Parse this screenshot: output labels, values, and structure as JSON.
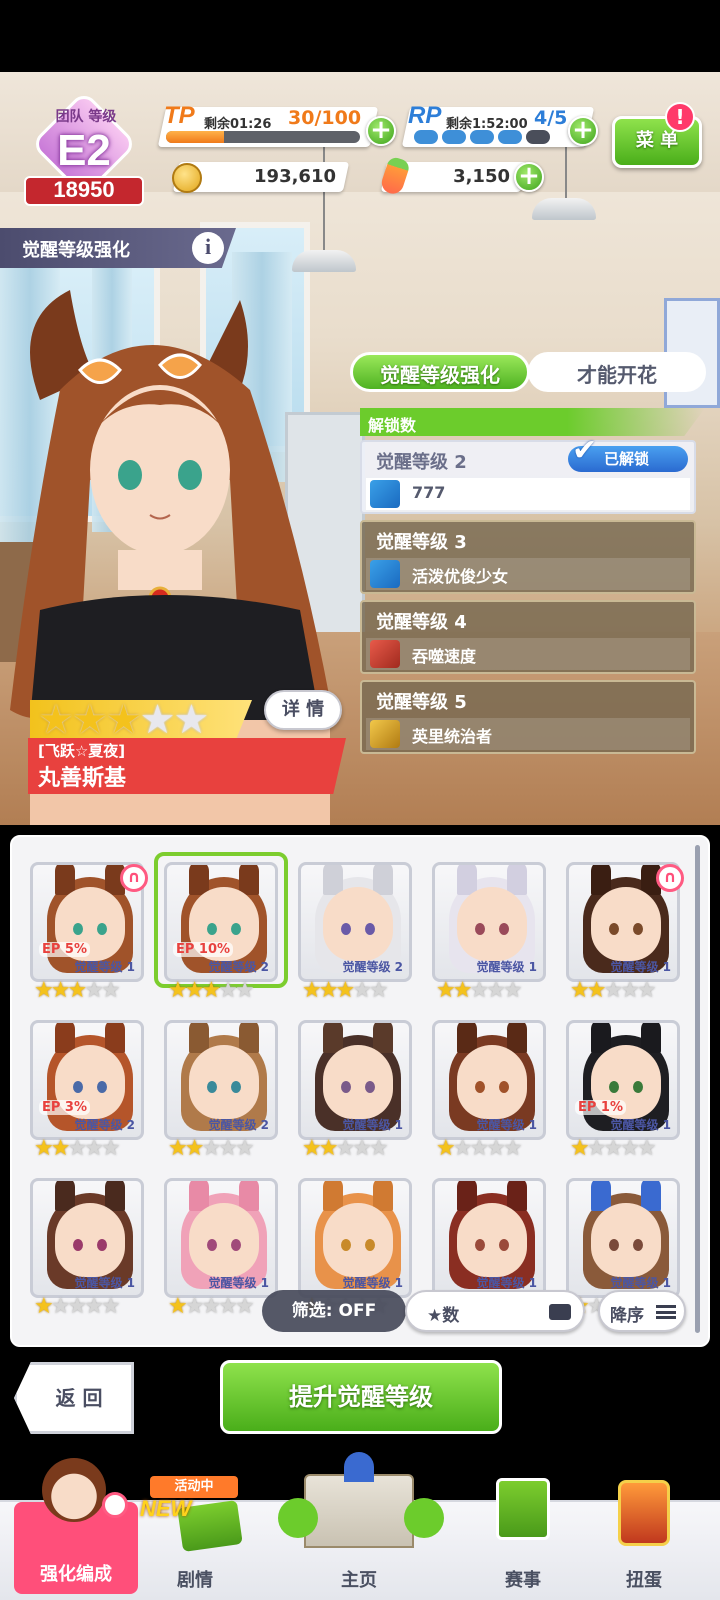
{
  "header": {
    "team_rank_title": "团队 等级",
    "team_rank": "E2",
    "team_score": "18950",
    "tp": {
      "label": "TP",
      "remain_label": "剩余01:26",
      "value": "30/100",
      "fill": 0.3
    },
    "rp": {
      "label": "RP",
      "remain_label": "剩余1:52:00",
      "value": "4/5",
      "filled": 4,
      "total": 5
    },
    "coins": "193,610",
    "carrots": "3,150",
    "menu_label": "菜 单",
    "menu_badge": "!"
  },
  "page_title": "觉醒等级强化",
  "info_icon": "i",
  "panel": {
    "tabs": [
      {
        "label": "觉醒等级强化",
        "active": true
      },
      {
        "label": "才能开花",
        "active": false
      }
    ],
    "section_label": "解锁数",
    "levels": [
      {
        "title": "觉醒等级 2",
        "skill": "777",
        "unlocked": true,
        "badge": "已解锁",
        "icon": "sparkle-blue-icon"
      },
      {
        "title": "觉醒等级 3",
        "skill": "活泼优俊少女",
        "unlocked": false,
        "icon": "sparkle-blue-icon"
      },
      {
        "title": "觉醒等级 4",
        "skill": "吞噬速度",
        "unlocked": false,
        "icon": "speed-red-icon"
      },
      {
        "title": "觉醒等级 5",
        "skill": "英里统治者",
        "unlocked": false,
        "icon": "crown-gold-icon"
      }
    ]
  },
  "character": {
    "stars": 3,
    "max_stars": 5,
    "epithet": "[飞跃☆夏夜]",
    "name": "丸善斯基",
    "detail_button": "详 情"
  },
  "roster": [
    {
      "awakening": "觉醒等级 1",
      "stars": 3,
      "ep": "EP 5%",
      "hair": "#a0532a",
      "ears": "#7a3a1c",
      "eyes": "#3aa38c",
      "horseshoe": true,
      "selected": false
    },
    {
      "awakening": "觉醒等级 2",
      "stars": 3,
      "ep": "EP 10%",
      "hair": "#a0532a",
      "ears": "#7a3a1c",
      "eyes": "#3aa38c",
      "horseshoe": false,
      "selected": true
    },
    {
      "awakening": "觉醒等级 2",
      "stars": 3,
      "ep": "",
      "hair": "#e6e6ea",
      "ears": "#cfd0d8",
      "eyes": "#6a5aa8",
      "horseshoe": false,
      "selected": false
    },
    {
      "awakening": "觉醒等级 1",
      "stars": 2,
      "ep": "",
      "hair": "#e7e4ee",
      "ears": "#d2cfe0",
      "eyes": "#9a4a5a",
      "horseshoe": false,
      "selected": false
    },
    {
      "awakening": "觉醒等级 1",
      "stars": 2,
      "ep": "",
      "hair": "#4a2a1c",
      "ears": "#3a1e12",
      "eyes": "#7a4a2a",
      "horseshoe": true,
      "selected": false
    },
    {
      "awakening": "觉醒等级 2",
      "stars": 2,
      "ep": "EP 3%",
      "hair": "#b5552a",
      "ears": "#8a3c1c",
      "eyes": "#4a6aa8",
      "horseshoe": false,
      "selected": false
    },
    {
      "awakening": "觉醒等级 2",
      "stars": 2,
      "ep": "",
      "hair": "#b07a4a",
      "ears": "#8a5a32",
      "eyes": "#3a8a9a",
      "horseshoe": false,
      "selected": false
    },
    {
      "awakening": "觉醒等级 1",
      "stars": 2,
      "ep": "",
      "hair": "#4a3028",
      "ears": "#5a3a2a",
      "eyes": "#7a5a8a",
      "horseshoe": false,
      "selected": false
    },
    {
      "awakening": "觉醒等级 1",
      "stars": 1,
      "ep": "",
      "hair": "#7a3a22",
      "ears": "#5a2a16",
      "eyes": "#a0522a",
      "horseshoe": false,
      "selected": false
    },
    {
      "awakening": "觉醒等级 1",
      "stars": 1,
      "ep": "EP 1%",
      "hair": "#1e1e22",
      "ears": "#1a1a1e",
      "eyes": "#3a7a3a",
      "horseshoe": false,
      "selected": false
    },
    {
      "awakening": "觉醒等级 1",
      "stars": 1,
      "ep": "",
      "hair": "#6a3a28",
      "ears": "#4a2a1e",
      "eyes": "#9a3a6a",
      "horseshoe": false,
      "selected": false
    },
    {
      "awakening": "觉醒等级 1",
      "stars": 1,
      "ep": "",
      "hair": "#f0a2b8",
      "ears": "#e88aa6",
      "eyes": "#a04a7a",
      "horseshoe": false,
      "selected": false
    },
    {
      "awakening": "觉醒等级 1",
      "stars": 1,
      "ep": "",
      "hair": "#e8924a",
      "ears": "#d07a32",
      "eyes": "#c88a2a",
      "horseshoe": false,
      "selected": false
    },
    {
      "awakening": "觉醒等级 1",
      "stars": 1,
      "ep": "",
      "hair": "#8a2e22",
      "ears": "#6a2218",
      "eyes": "#9a4a3a",
      "horseshoe": false,
      "selected": false
    },
    {
      "awakening": "觉醒等级 1",
      "stars": 1,
      "ep": "",
      "hair": "#8a5a3a",
      "ears": "#3a6ad0",
      "eyes": "#7a4a3a",
      "horseshoe": false,
      "selected": false
    }
  ],
  "filter": {
    "label": "筛选: OFF",
    "sort_key": "★数",
    "order": "降序"
  },
  "actions": {
    "back": "返 回",
    "upgrade": "提升觉醒等级"
  },
  "nav": [
    {
      "label": "强化编成",
      "active": true
    },
    {
      "label": "剧情",
      "badge_top": "活动中",
      "badge_new": "NEW"
    },
    {
      "label": "主页"
    },
    {
      "label": "赛事"
    },
    {
      "label": "扭蛋"
    }
  ]
}
